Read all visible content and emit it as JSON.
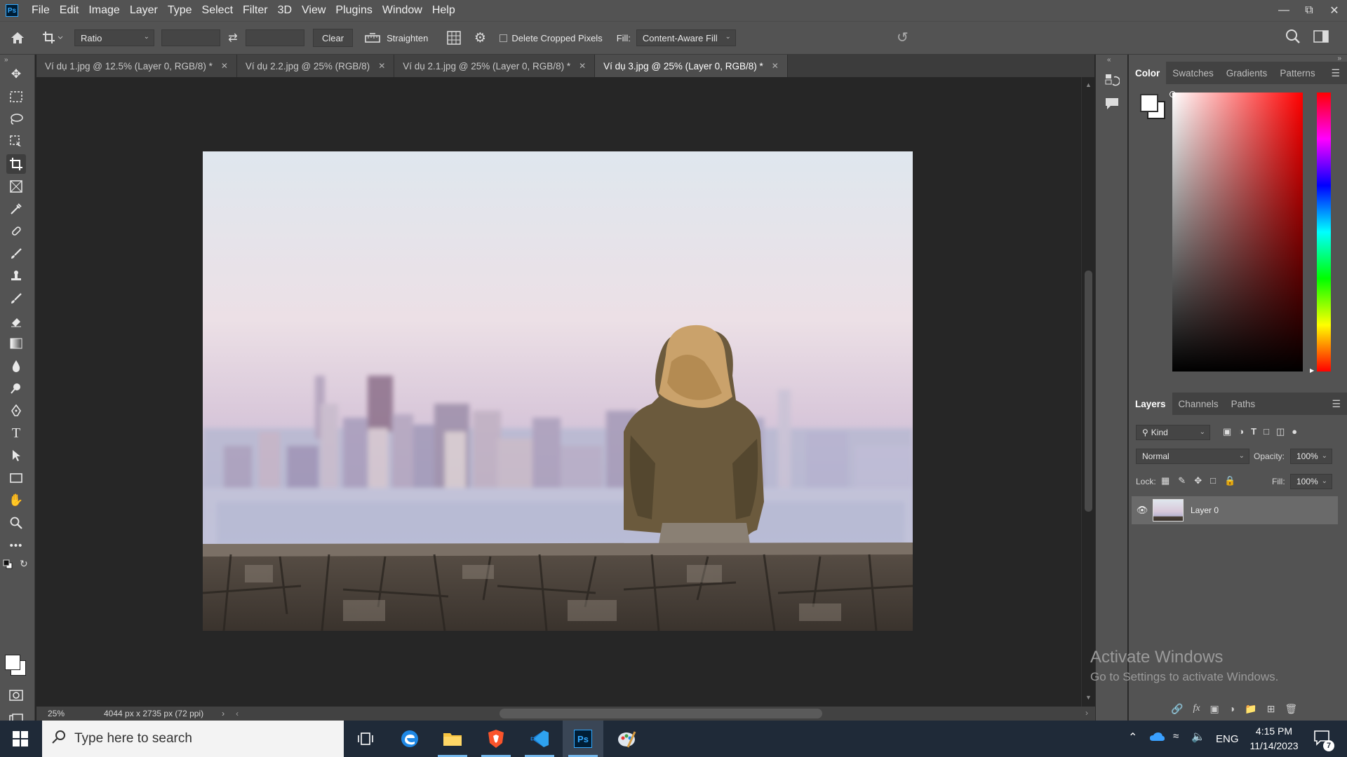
{
  "menubar": {
    "logo": "Ps",
    "items": [
      "File",
      "Edit",
      "Image",
      "Layer",
      "Type",
      "Select",
      "Filter",
      "3D",
      "View",
      "Plugins",
      "Window",
      "Help"
    ]
  },
  "options": {
    "ratio_label": "Ratio",
    "clear_label": "Clear",
    "straighten_label": "Straighten",
    "delete_cropped_label": "Delete Cropped Pixels",
    "fill_label": "Fill:",
    "fill_value": "Content-Aware Fill"
  },
  "tabs": [
    {
      "label": "Ví dụ 1.jpg @ 12.5% (Layer 0, RGB/8) *",
      "active": false
    },
    {
      "label": "Ví dụ 2.2.jpg @ 25% (RGB/8)",
      "active": false
    },
    {
      "label": "Ví dụ 2.1.jpg @ 25% (Layer 0, RGB/8) *",
      "active": false
    },
    {
      "label": "Ví dụ 3.jpg @ 25% (Layer 0, RGB/8) *",
      "active": true
    }
  ],
  "status": {
    "zoom": "25%",
    "doc_info": "4044 px x 2735 px (72 ppi)"
  },
  "color_panel": {
    "tabs": [
      "Color",
      "Swatches",
      "Gradients",
      "Patterns"
    ]
  },
  "layers_panel": {
    "tabs": [
      "Layers",
      "Channels",
      "Paths"
    ],
    "filter_kind": "Kind",
    "blend_mode": "Normal",
    "opacity_label": "Opacity:",
    "opacity_value": "100%",
    "lock_label": "Lock:",
    "fill_label": "Fill:",
    "fill_value": "100%",
    "layers": [
      {
        "name": "Layer 0"
      }
    ]
  },
  "watermark": {
    "title": "Activate Windows",
    "subtitle": "Go to Settings to activate Windows."
  },
  "taskbar": {
    "search_placeholder": "Type here to search",
    "lang": "ENG",
    "time": "4:15 PM",
    "date": "11/14/2023",
    "notif_count": "7"
  }
}
